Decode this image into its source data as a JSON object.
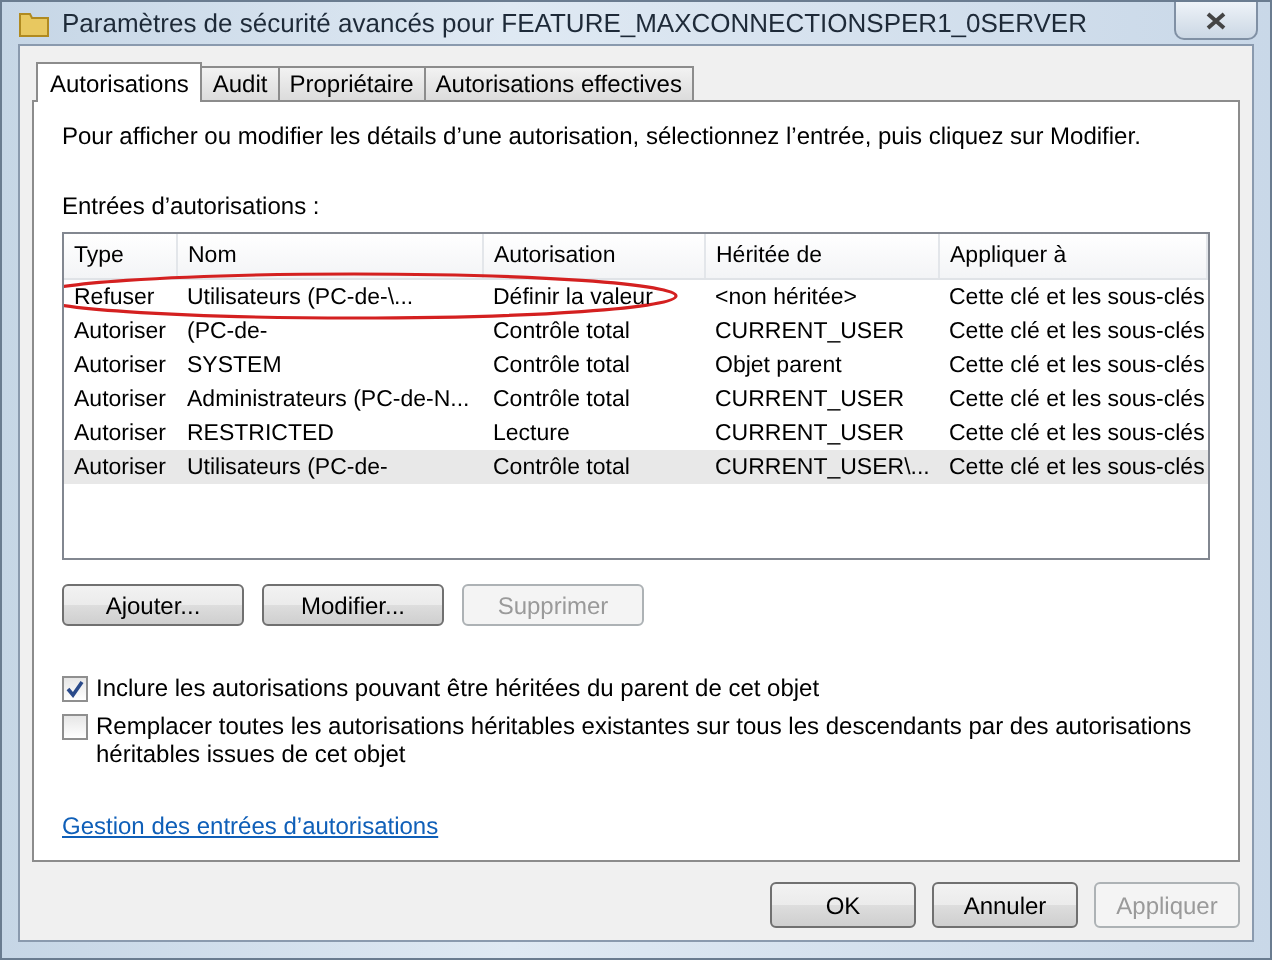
{
  "window": {
    "title": "Paramètres de sécurité avancés pour FEATURE_MAXCONNECTIONSPER1_0SERVER"
  },
  "tabs": [
    {
      "label": "Autorisations",
      "selected": true
    },
    {
      "label": "Audit",
      "selected": false
    },
    {
      "label": "Propriétaire",
      "selected": false
    },
    {
      "label": "Autorisations effectives",
      "selected": false
    }
  ],
  "intro": "Pour afficher ou modifier les détails d’une autorisation, sélectionnez l’entrée, puis cliquez sur Modifier.",
  "table": {
    "label": "Entrées d’autorisations :",
    "columns": [
      "Type",
      "Nom",
      "Autorisation",
      "Héritée de",
      "Appliquer à"
    ],
    "rows": [
      {
        "cells": [
          "Refuser",
          "Utilisateurs (PC-de-\\...",
          "Définir la valeur",
          "<non héritée>",
          "Cette clé et les sous-clés"
        ],
        "selected": false,
        "circled": true
      },
      {
        "cells": [
          "Autoriser",
          "(PC-de-",
          "Contrôle total",
          "CURRENT_USER",
          "Cette clé et les sous-clés"
        ],
        "selected": false,
        "circled": false
      },
      {
        "cells": [
          "Autoriser",
          "SYSTEM",
          "Contrôle total",
          "Objet parent",
          "Cette clé et les sous-clés"
        ],
        "selected": false,
        "circled": false
      },
      {
        "cells": [
          "Autoriser",
          "Administrateurs (PC-de-N...",
          "Contrôle total",
          "CURRENT_USER",
          "Cette clé et les sous-clés"
        ],
        "selected": false,
        "circled": false
      },
      {
        "cells": [
          "Autoriser",
          "RESTRICTED",
          "Lecture",
          "CURRENT_USER",
          "Cette clé et les sous-clés"
        ],
        "selected": false,
        "circled": false
      },
      {
        "cells": [
          "Autoriser",
          "Utilisateurs (PC-de-",
          "Contrôle total",
          "CURRENT_USER\\...",
          "Cette clé et les sous-clés"
        ],
        "selected": true,
        "circled": false
      }
    ]
  },
  "entry_buttons": [
    {
      "label": "Ajouter...",
      "disabled": false
    },
    {
      "label": "Modifier...",
      "disabled": false
    },
    {
      "label": "Supprimer",
      "disabled": true
    }
  ],
  "checkboxes": [
    {
      "label": "Inclure les autorisations pouvant être héritées du parent de cet objet",
      "checked": true
    },
    {
      "label": "Remplacer toutes les autorisations héritables existantes sur tous les descendants par des autorisations héritables issues de cet objet",
      "checked": false
    }
  ],
  "link": "Gestion des entrées d’autorisations",
  "dialog_buttons": [
    {
      "label": "OK",
      "disabled": false
    },
    {
      "label": "Annuler",
      "disabled": false
    },
    {
      "label": "Appliquer",
      "disabled": true
    }
  ]
}
